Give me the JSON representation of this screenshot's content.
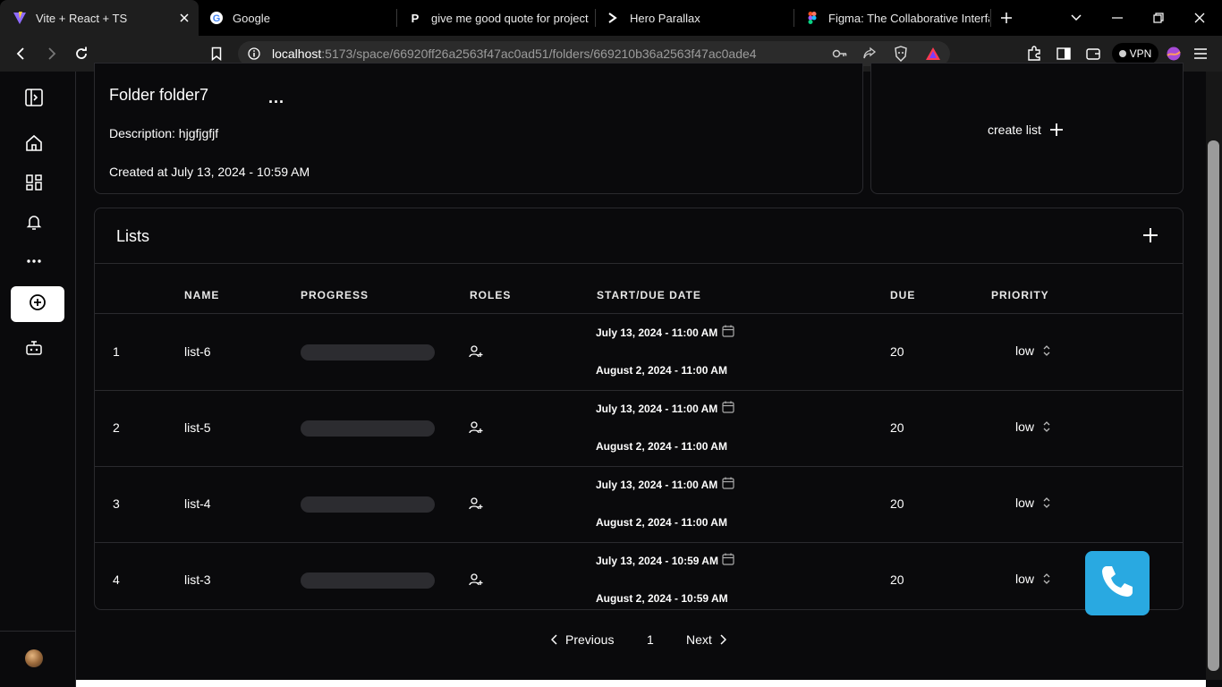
{
  "browser": {
    "tabs": [
      {
        "title": "Vite + React + TS",
        "icon": "vite-logo-icon",
        "active": true
      },
      {
        "title": "Google",
        "icon": "google-logo-icon",
        "active": false
      },
      {
        "title": "give me good quote for project m",
        "icon": "perplexity-logo-icon",
        "active": false
      },
      {
        "title": "Hero Parallax",
        "icon": "terminal-prompt-icon",
        "active": false
      },
      {
        "title": "Figma: The Collaborative Interfac",
        "icon": "figma-logo-icon",
        "active": false
      }
    ],
    "url_host": "localhost",
    "url_path": ":5173/space/66920ff26a2563f47ac0ad51/folders/669210b36a2563f47ac0ade4",
    "vpn_label": "VPN"
  },
  "folder": {
    "title": "Folder folder7",
    "more": "...",
    "description": "Description: hjgfjgfjf",
    "created": "Created at July 13, 2024 - 10:59 AM"
  },
  "create_list": {
    "label": "create list"
  },
  "lists": {
    "title": "Lists",
    "columns": [
      "NAME",
      "PROGRESS",
      "ROLES",
      "START/DUE DATE",
      "DUE",
      "PRIORITY"
    ],
    "rows": [
      {
        "index": "1",
        "name": "list-6",
        "progress": 0,
        "start": "July 13, 2024 - 11:00 AM",
        "due_date": "August 2, 2024 - 11:00 AM",
        "due": "20",
        "priority": "low"
      },
      {
        "index": "2",
        "name": "list-5",
        "progress": 0,
        "start": "July 13, 2024 - 11:00 AM",
        "due_date": "August 2, 2024 - 11:00 AM",
        "due": "20",
        "priority": "low"
      },
      {
        "index": "3",
        "name": "list-4",
        "progress": 0,
        "start": "July 13, 2024 - 11:00 AM",
        "due_date": "August 2, 2024 - 11:00 AM",
        "due": "20",
        "priority": "low"
      },
      {
        "index": "4",
        "name": "list-3",
        "progress": 0,
        "start": "July 13, 2024 - 10:59 AM",
        "due_date": "August 2, 2024 - 10:59 AM",
        "due": "20",
        "priority": "low"
      }
    ]
  },
  "pagination": {
    "previous": "Previous",
    "page": "1",
    "next": "Next"
  },
  "colors": {
    "call_button": "#29a9e1",
    "background": "#0a0a0c",
    "border": "#2a2a2e"
  }
}
